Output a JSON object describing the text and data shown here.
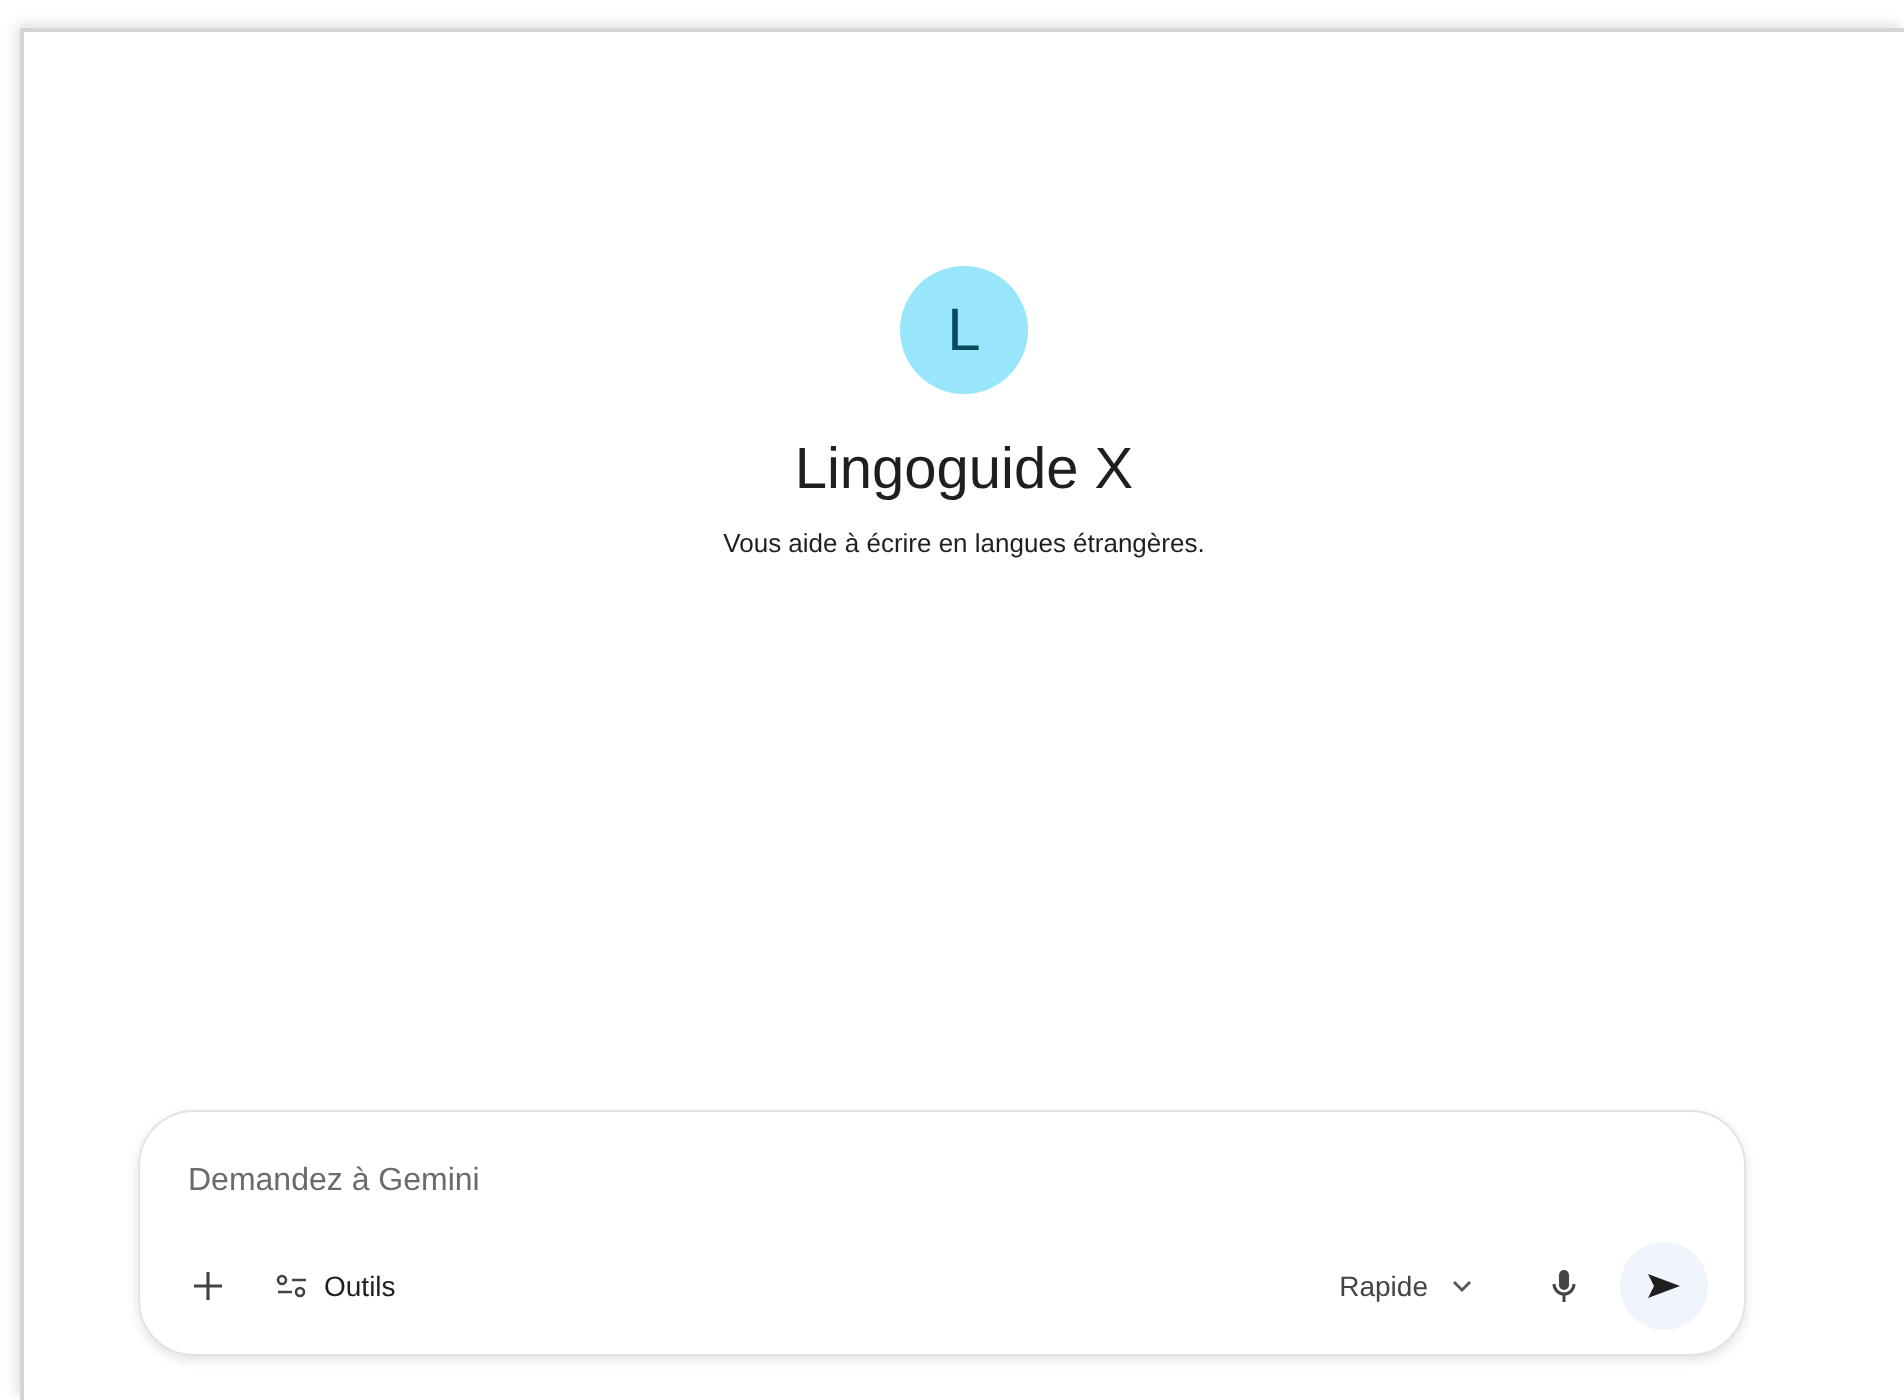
{
  "assistant": {
    "initial": "L",
    "name": "Lingoguide X",
    "description": "Vous aide à écrire en langues étrangères."
  },
  "prompt": {
    "placeholder": "Demandez à Gemini",
    "tools_label": "Outils",
    "mode": "Rapide"
  }
}
